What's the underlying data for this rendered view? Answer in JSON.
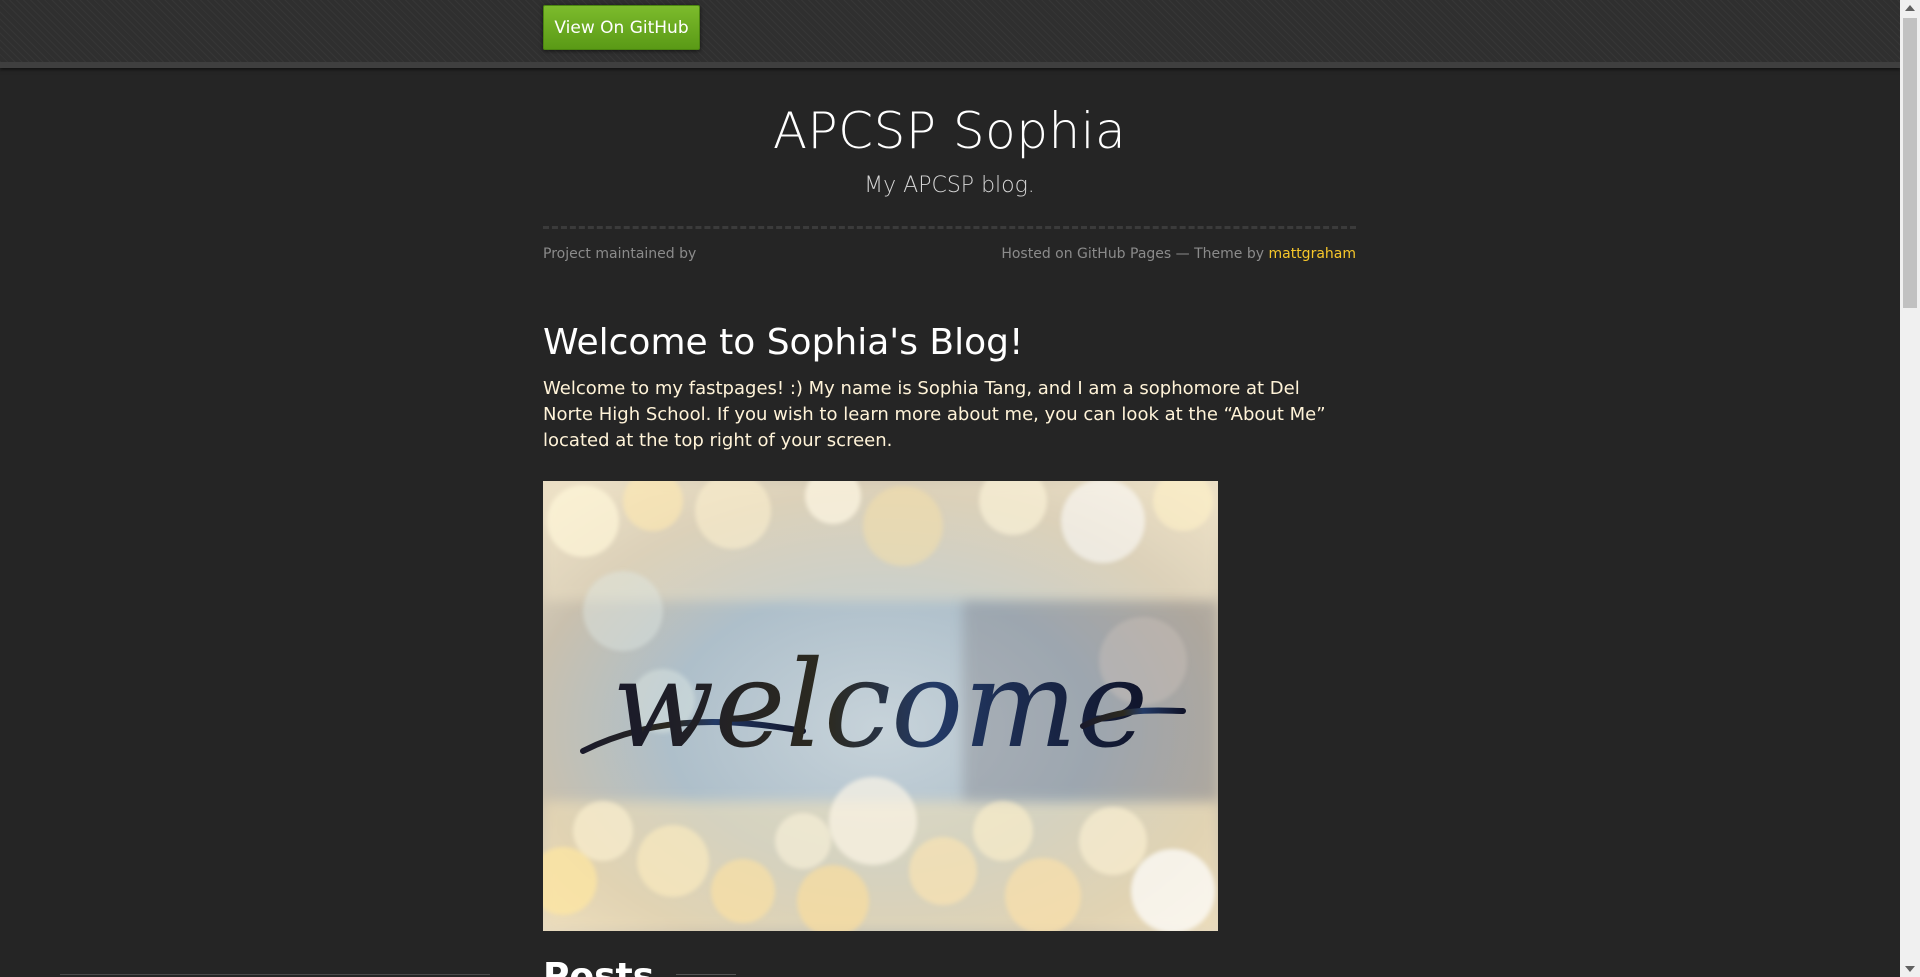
{
  "header": {
    "github_button_label": "View On GitHub"
  },
  "site": {
    "title": "APCSP Sophia",
    "tagline": "My APCSP blog."
  },
  "footer": {
    "maintained_text": "Project maintained by",
    "hosted_text": "Hosted on GitHub Pages — Theme by ",
    "theme_author": "mattgraham"
  },
  "post": {
    "heading": "Welcome to Sophia's Blog!",
    "body": "Welcome to my fastpages! :) My name is Sophia Tang, and I am a sophomore at Del Norte High School. If you wish to learn more about me, you can look at the “About Me” located at the top right of your screen.",
    "image_text": "welcome"
  },
  "posts_section": {
    "heading": "Posts"
  },
  "colors": {
    "background": "#252525",
    "button_green": "#6aab21",
    "link_yellow": "#f7c72a"
  }
}
